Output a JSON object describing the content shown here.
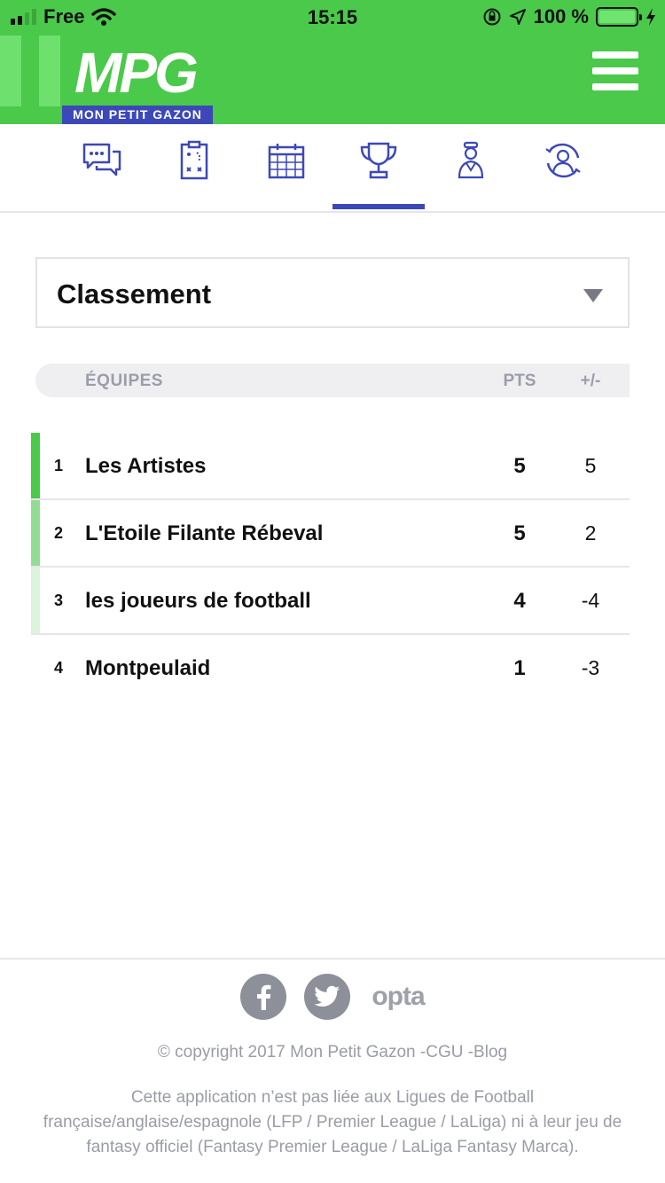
{
  "status_bar": {
    "carrier": "Free",
    "time": "15:15",
    "battery": "100 %"
  },
  "header": {
    "logo": "MPG",
    "logo_subtitle": "MON PETIT GAZON"
  },
  "nav": {
    "items": [
      {
        "name": "chat",
        "icon": "chat-bubbles-icon"
      },
      {
        "name": "tactics",
        "icon": "tactics-board-icon"
      },
      {
        "name": "calendar",
        "icon": "calendar-icon"
      },
      {
        "name": "trophy",
        "icon": "trophy-icon",
        "active": true
      },
      {
        "name": "player",
        "icon": "player-bust-icon"
      },
      {
        "name": "profile",
        "icon": "user-circle-icon"
      }
    ],
    "active_color": "#3d48b8"
  },
  "dropdown": {
    "selected": "Classement"
  },
  "table": {
    "headers": {
      "team": "ÉQUIPES",
      "pts": "PTS",
      "diff": "+/-"
    },
    "rows": [
      {
        "rank": "1",
        "team": "Les Artistes",
        "pts": "5",
        "diff": "5",
        "marker_color": "#4ac94a"
      },
      {
        "rank": "2",
        "team": "L'Etoile Filante Rébeval",
        "pts": "5",
        "diff": "2",
        "marker_color": "#93dd93"
      },
      {
        "rank": "3",
        "team": "les joueurs de football",
        "pts": "4",
        "diff": "-4",
        "marker_color": "#dcf4dc"
      },
      {
        "rank": "4",
        "team": "Montpeulaid",
        "pts": "1",
        "diff": "-3",
        "marker_color": "#ffffff"
      }
    ]
  },
  "footer": {
    "social": [
      "facebook-icon",
      "twitter-icon"
    ],
    "opta": "opta",
    "copyright": "© copyright 2017 Mon Petit Gazon -CGU -Blog",
    "disclaimer": "Cette application n’est pas liée aux Ligues de Football française/anglaise/espagnole (LFP / Premier League / LaLiga) ni à leur jeu de fantasy officiel (Fantasy Premier League / LaLiga Fantasy Marca)."
  },
  "colors": {
    "brand_green": "#4ac94a",
    "brand_blue": "#3d48b8"
  }
}
